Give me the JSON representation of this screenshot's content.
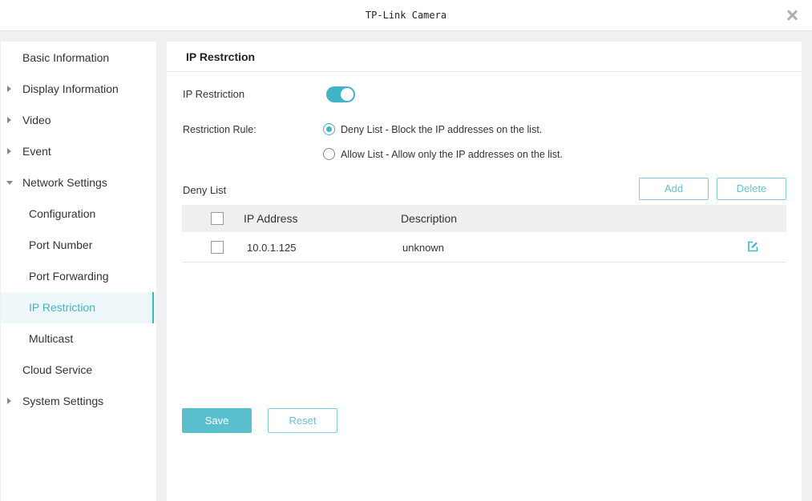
{
  "window": {
    "title": "TP-Link Camera"
  },
  "sidebar": {
    "items": [
      {
        "label": "Basic Information",
        "arrow": "none"
      },
      {
        "label": "Display Information",
        "arrow": "right"
      },
      {
        "label": "Video",
        "arrow": "right"
      },
      {
        "label": "Event",
        "arrow": "right"
      },
      {
        "label": "Network Settings",
        "arrow": "down"
      },
      {
        "label": "Configuration",
        "sub": true
      },
      {
        "label": "Port Number",
        "sub": true
      },
      {
        "label": "Port Forwarding",
        "sub": true
      },
      {
        "label": "IP Restriction",
        "sub": true,
        "active": true
      },
      {
        "label": "Multicast",
        "sub": true
      },
      {
        "label": "Cloud Service",
        "arrow": "none"
      },
      {
        "label": "System Settings",
        "arrow": "right"
      }
    ]
  },
  "main": {
    "header": "IP Restrction",
    "ip_restriction": {
      "label": "IP Restriction",
      "enabled": true
    },
    "rule": {
      "label": "Restriction Rule:",
      "options": [
        {
          "label": "Deny List - Block the IP addresses on the list.",
          "checked": true
        },
        {
          "label": "Allow List - Allow only the IP addresses on the list.",
          "checked": false
        }
      ]
    },
    "list": {
      "title": "Deny List",
      "add_label": "Add",
      "delete_label": "Delete",
      "columns": [
        "IP Address",
        "Description"
      ],
      "rows": [
        {
          "ip": "10.0.1.125",
          "description": "unknown"
        }
      ]
    },
    "save_label": "Save",
    "reset_label": "Reset"
  },
  "colors": {
    "accent": "#3fb5c7",
    "accent_light": "#5bc0ce",
    "active_bg": "#eef7fa"
  }
}
